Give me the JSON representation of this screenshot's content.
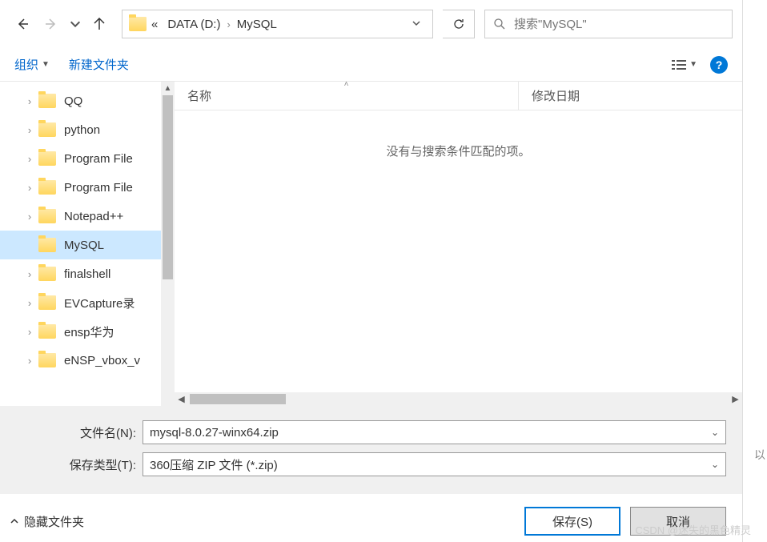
{
  "nav": {
    "path_prefix": "«",
    "path_segments": [
      "DATA (D:)",
      "MySQL"
    ]
  },
  "search": {
    "placeholder": "搜索\"MySQL\""
  },
  "toolbar": {
    "organize": "组织",
    "new_folder": "新建文件夹"
  },
  "tree": {
    "items": [
      {
        "label": "eNSP_vbox_v",
        "expandable": true,
        "selected": false
      },
      {
        "label": "ensp华为",
        "expandable": true,
        "selected": false
      },
      {
        "label": "EVCapture录",
        "expandable": true,
        "selected": false
      },
      {
        "label": "finalshell",
        "expandable": true,
        "selected": false
      },
      {
        "label": "MySQL",
        "expandable": false,
        "selected": true
      },
      {
        "label": "Notepad++",
        "expandable": true,
        "selected": false
      },
      {
        "label": "Program File",
        "expandable": true,
        "selected": false
      },
      {
        "label": "Program File",
        "expandable": true,
        "selected": false
      },
      {
        "label": "python",
        "expandable": true,
        "selected": false
      },
      {
        "label": "QQ",
        "expandable": true,
        "selected": false
      }
    ]
  },
  "content": {
    "columns": {
      "name": "名称",
      "modified": "修改日期"
    },
    "empty_message": "没有与搜索条件匹配的项。"
  },
  "form": {
    "filename_label": "文件名(N):",
    "filename_value": "mysql-8.0.27-winx64.zip",
    "filetype_label": "保存类型(T):",
    "filetype_value": "360压缩 ZIP 文件 (*.zip)"
  },
  "footer": {
    "hide_folders": "隐藏文件夹",
    "save": "保存(S)",
    "cancel": "取消"
  },
  "watermark": "CSDN @迷失的黑色精灵",
  "side_text": "以"
}
